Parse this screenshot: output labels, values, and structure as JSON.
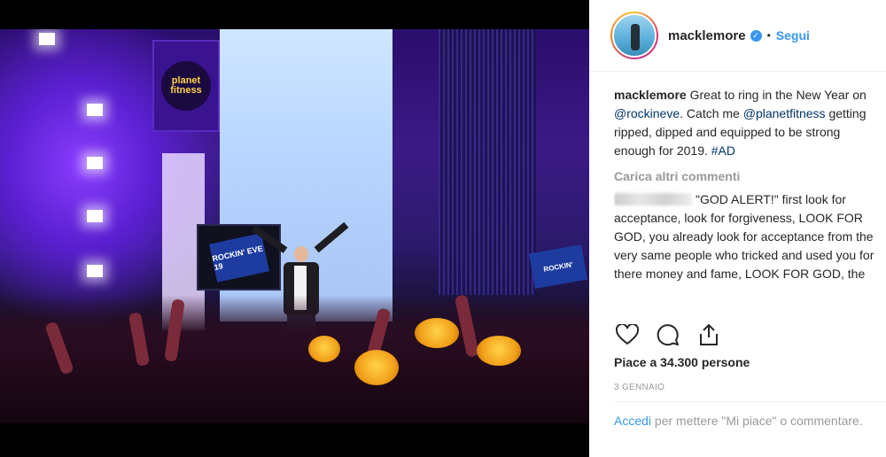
{
  "post": {
    "author": "macklemore",
    "follow_label": "Segui",
    "separator": "•",
    "photo_alt": "Macklemore performing on stage",
    "signs": {
      "planet_fitness": "planet fitness",
      "rockin_eve": "ROCKIN' EVE 19",
      "rockin_eve_small": "ROCKIN'"
    }
  },
  "caption": {
    "user": "macklemore",
    "text_1": "Great to ring in the New Year on ",
    "mention_1": "@rockineve",
    "text_2": ". Catch me ",
    "mention_2": "@planetfitness",
    "text_3": " getting ripped, dipped and equipped to be strong enough for 2019. ",
    "hashtag": "#AD"
  },
  "load_more": "Carica altri commenti",
  "comment": {
    "text": "\"GOD ALERT!\" first look for acceptance, look for forgiveness, LOOK FOR GOD, you already look for acceptance from the very same people who tricked and used you for there money and fame, LOOK FOR GOD, the"
  },
  "actions": {
    "like": "heart-icon",
    "comment": "comment-icon",
    "share": "share-icon"
  },
  "likes_text": "Piace a 34.300 persone",
  "date": "3 GENNAIO",
  "login": {
    "link": "Accedi",
    "rest": " per mettere \"Mi piace\" o commentare."
  }
}
